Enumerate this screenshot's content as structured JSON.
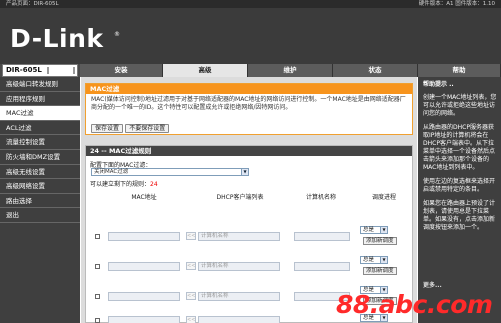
{
  "topbar": {
    "left": "产品页面：DIR-605L",
    "right": "硬件版本：A1   固件版本：1.10"
  },
  "brand": {
    "logo": "D-Link",
    "mark": "®"
  },
  "model": "DIR-605L",
  "tabs": [
    {
      "label": "安装",
      "active": false
    },
    {
      "label": "高级",
      "active": true
    },
    {
      "label": "维护",
      "active": false
    },
    {
      "label": "状态",
      "active": false
    },
    {
      "label": "帮助",
      "active": false
    }
  ],
  "sidebar": {
    "items": [
      {
        "label": "高级端口转发规则",
        "active": false
      },
      {
        "label": "应用程序规则",
        "active": false
      },
      {
        "label": "MAC过滤",
        "active": true
      },
      {
        "label": "ACL过滤",
        "active": false
      },
      {
        "label": "流量控制设置",
        "active": false
      },
      {
        "label": "防火墙和DMZ设置",
        "active": false
      },
      {
        "label": "高级无线设置",
        "active": false
      },
      {
        "label": "高级网络设置",
        "active": false
      },
      {
        "label": "路由选择",
        "active": false
      },
      {
        "label": "退出",
        "active": false
      }
    ]
  },
  "intro": {
    "title": "MAC过滤",
    "text": "MAC(媒体访问控制)地址过滤用于对基于网络适配器的MAC地址的网络访问进行控制。一个MAC地址是由网络适配器厂商分配的一个唯一的ID。这个特性可以配置成允许或拒绝网络/因特网访问。",
    "save_label": "保存设置",
    "nosave_label": "不要保存设置"
  },
  "rules": {
    "title": "24 -- MAC过滤规则",
    "config_label": "配置下面的MAC过滤：",
    "mode_value": "关闭MAC过滤",
    "remaining_label": "可以建立剩下的规则：",
    "remaining_value": "24",
    "columns": [
      "MAC地址",
      "DHCP客户端列表",
      "计算机名称",
      "调度进程"
    ],
    "rows": [
      {
        "client_placeholder": "计算机名称",
        "schedule": "总是",
        "add_label": "添加新调度"
      },
      {
        "client_placeholder": "计算机名称",
        "schedule": "总是",
        "add_label": "添加新调度"
      },
      {
        "client_placeholder": "计算机名称",
        "schedule": "总是",
        "add_label": "添加新调度"
      },
      {
        "client_placeholder": "",
        "schedule": "总是",
        "add_label": ""
      }
    ],
    "shift_label": "<<"
  },
  "help": {
    "title": "帮助提示 ..",
    "paragraphs": [
      "创建一个MAC地址列表，您可以允许或拒绝这些地址访问您的网络。",
      "从路由器的DHCP服务器获取IP地址的计算机将会在DHCP客户端表中。从下拉菜单中选择一个设备然后点击箭头来添加那个设备的MAC地址到列表中。",
      "使用左边的复选框来选择开启或禁用特定的条目。",
      "如果您在路由器上预设了计划表，请使用总是下拉菜单。如果没有，点击添加新调度按钮来添加一个。"
    ],
    "more": "更多..."
  },
  "watermark": "88.abc.com"
}
